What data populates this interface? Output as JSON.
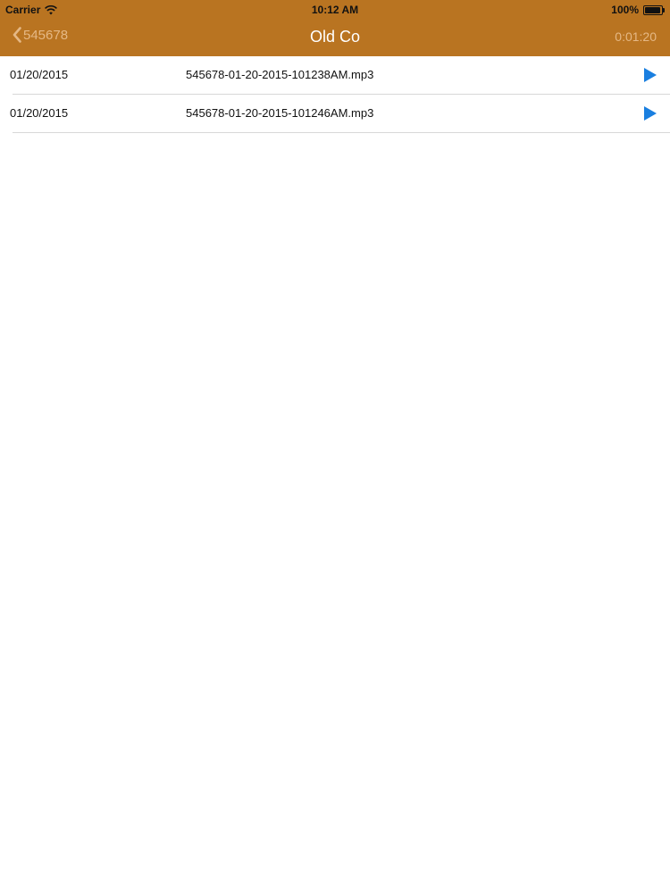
{
  "status_bar": {
    "carrier": "Carrier",
    "time": "10:12 AM",
    "battery": "100%"
  },
  "nav": {
    "back_label": "545678",
    "title": "Old Co",
    "duration": "0:01:20"
  },
  "colors": {
    "header_bg": "#B97421",
    "header_muted_text": "#E5B885",
    "play_icon": "#1A7FE0"
  },
  "recordings": [
    {
      "date": "01/20/2015",
      "file": "545678-01-20-2015-101238AM.mp3"
    },
    {
      "date": "01/20/2015",
      "file": "545678-01-20-2015-101246AM.mp3"
    }
  ]
}
